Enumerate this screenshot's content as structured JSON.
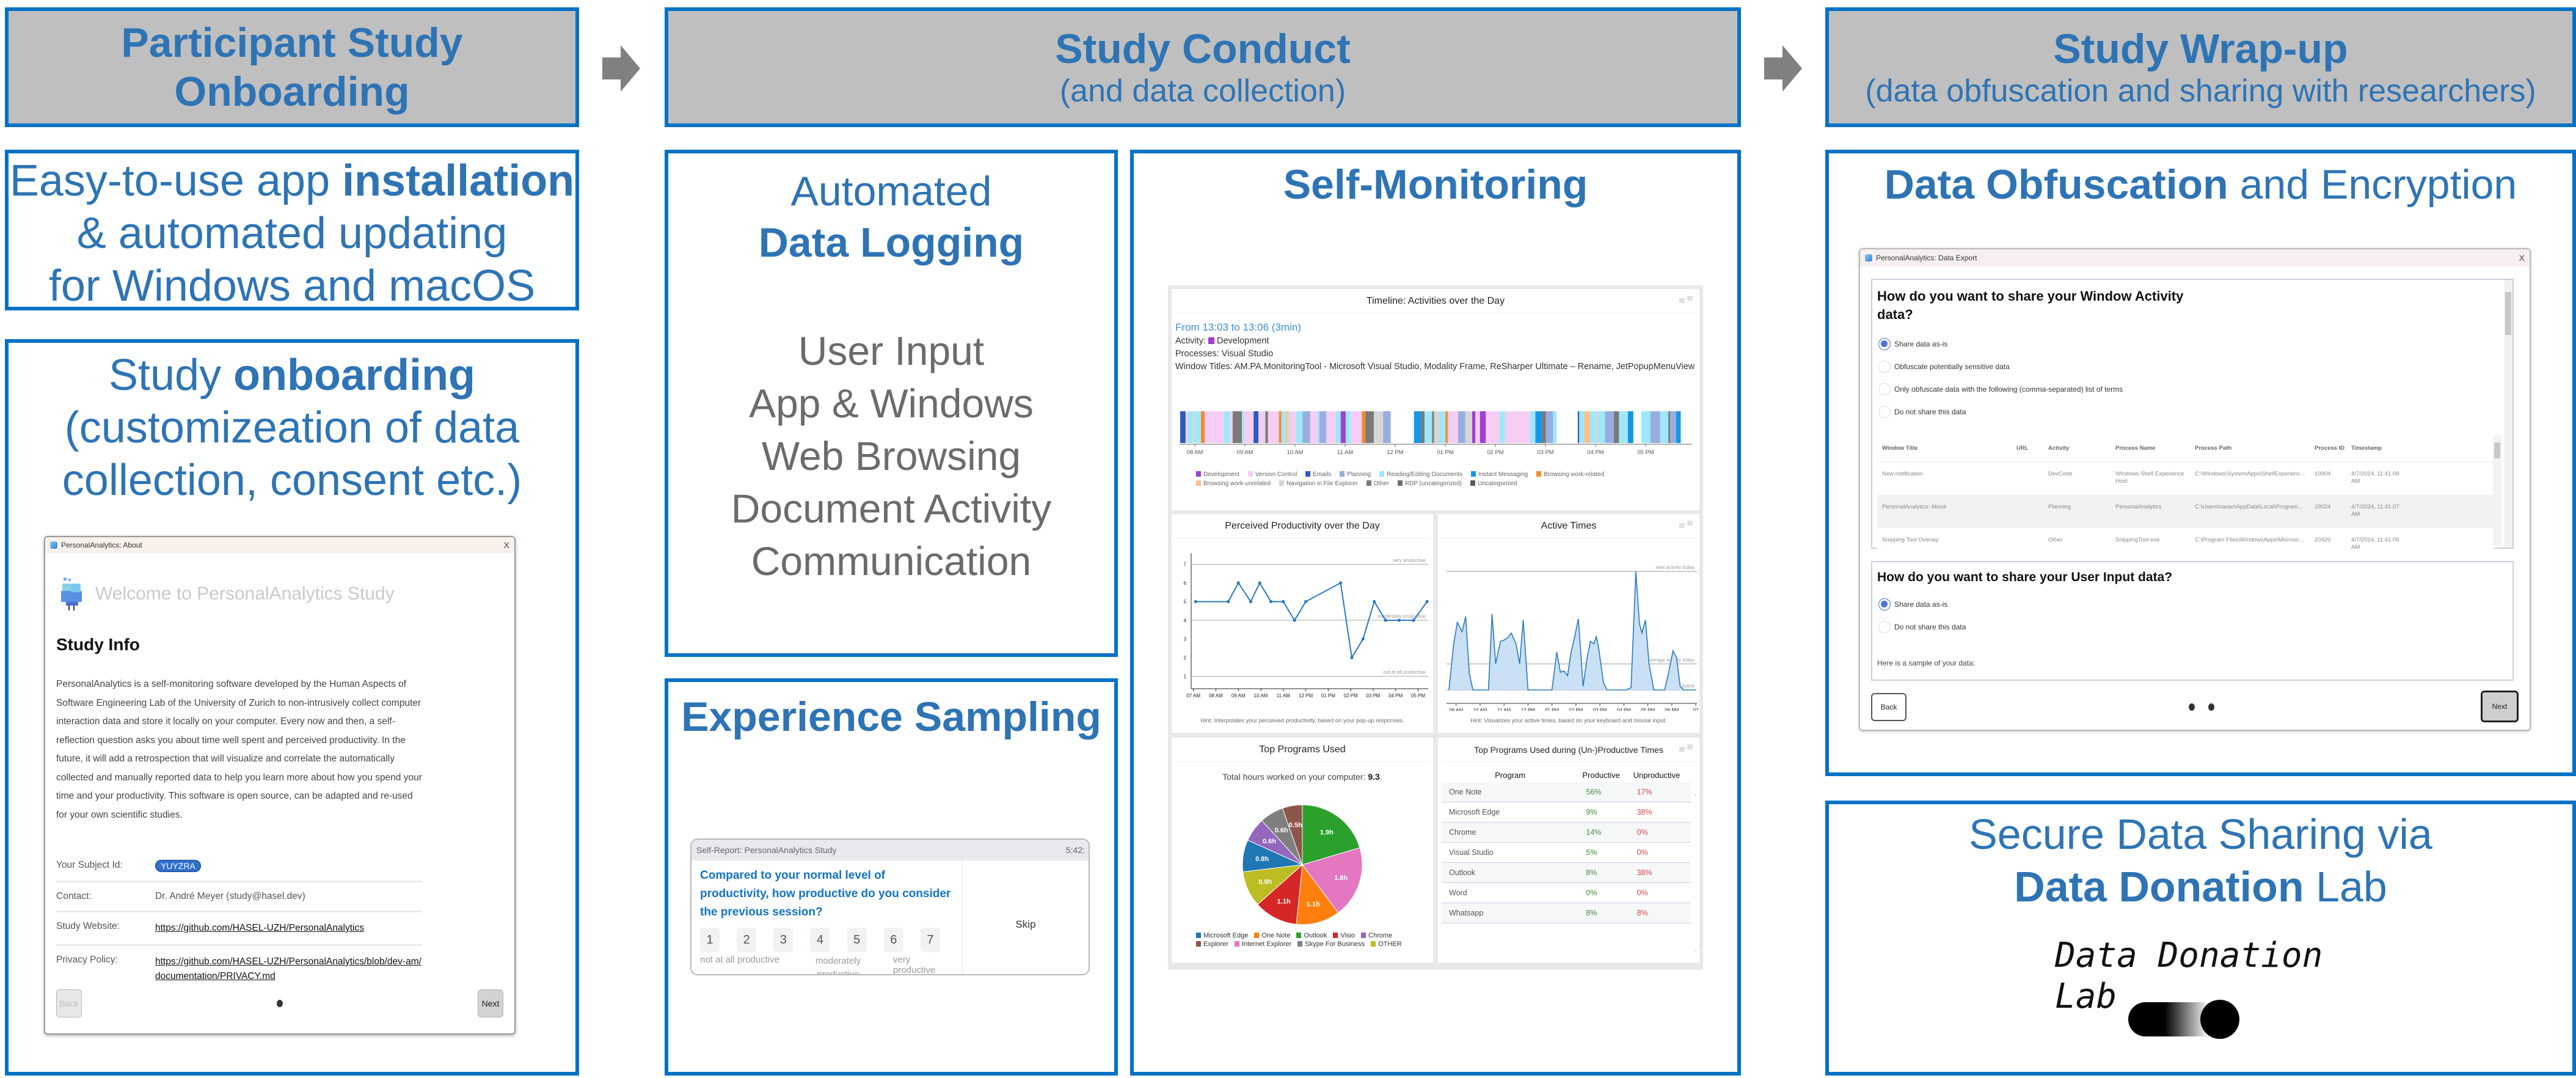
{
  "phases": [
    {
      "title": "Participant Study Onboarding",
      "subtitle": ""
    },
    {
      "title": "Study Conduct",
      "subtitle": "(and data collection)"
    },
    {
      "title": "Study Wrap-up",
      "subtitle": "(data obfuscation and sharing with researchers)"
    }
  ],
  "arrows": [
    "arrow-right-icon",
    "arrow-right-icon"
  ],
  "onboarding": {
    "install_box": {
      "line1_pre": "Easy-to-use app ",
      "line1_bold": "installation",
      "line2": "& automated updating",
      "line3": "for Windows and macOS"
    },
    "study_box": {
      "title_pre": "Study ",
      "title_bold": "onboarding",
      "line2": "(customizeation of data",
      "line3": "collection, consent etc.)"
    },
    "about_dialog": {
      "window_title": "PersonalAnalytics: About",
      "close": "X",
      "welcome": "Welcome to PersonalAnalytics Study",
      "heading": "Study Info",
      "description": "PersonalAnalytics is a self-monitoring software developed by the Human Aspects of Software Engineering Lab of the University of Zurich to non-intrusively collect computer interaction data and store it locally on your computer. Every now and then, a self-reflection question asks you about time well spent and perceived productivity. In the future, it will add a retrospection that will visualize and correlate the automatically collected and manually reported data to help you learn more about how you spend your time and your productivity. This software is open source, can be adapted and re-used for your own scientific studies.",
      "rows": [
        {
          "label": "Your Subject Id:",
          "value": "YUYZRA",
          "type": "badge"
        },
        {
          "label": "Contact:",
          "value": "Dr. André Meyer (study@hasel.dev)",
          "type": "text"
        },
        {
          "label": "Study Website:",
          "value": "https://github.com/HASEL-UZH/PersonalAnalytics",
          "type": "link"
        },
        {
          "label": "Privacy Policy:",
          "value": "https://github.com/HASEL-UZH/PersonalAnalytics/blob/dev-am/documentation/PRIVACY.md",
          "type": "link"
        }
      ],
      "back_label": "Back",
      "next_label": "Next",
      "page_dots": 1
    }
  },
  "conduct": {
    "logging": {
      "title_line1": "Automated",
      "title_line2": "Data Logging",
      "items": [
        "User Input",
        "App & Windows",
        "Web Browsing",
        "Document Activity",
        "Communication"
      ]
    },
    "experience_sampling": {
      "title": "Experience Sampling",
      "popup": {
        "header": "Self-Report: PersonalAnalytics Study",
        "time": "5:42:",
        "question": "Compared to your normal level of productivity, how productive do you consider the previous session?",
        "scale": [
          "1",
          "2",
          "3",
          "4",
          "5",
          "6",
          "7"
        ],
        "label_low": "not at all productive",
        "label_mid": "moderately productive",
        "label_high": "very productive",
        "skip_label": "Skip"
      }
    },
    "self_monitoring": {
      "title": "Self-Monitoring",
      "timeline": {
        "title": "Timeline: Activities over the Day",
        "from": "From 13:03 to 13:06 (3min)",
        "activity_label": "Activity:",
        "activity_value": "Development",
        "processes_label": "Processes:",
        "processes_value": "Visual Studio",
        "windows_label": "Window Titles:",
        "windows_value": "AM.PA.MonitoringTool - Microsoft Visual Studio, Modality Frame, ReSharper Ultimate – Rename, JetPopupMenuView",
        "ticks": [
          "08 AM",
          "09 AM",
          "10 AM",
          "11 AM",
          "12 PM",
          "01 PM",
          "02 PM",
          "03 PM",
          "04 PM",
          "05 PM"
        ],
        "legend": [
          {
            "label": "Development",
            "color": "#a03fd0"
          },
          {
            "label": "Version Control",
            "color": "#f5cdf3"
          },
          {
            "label": "Emails",
            "color": "#2a5cc0"
          },
          {
            "label": "Planning",
            "color": "#98aee0"
          },
          {
            "label": "Reading/Editing Documents",
            "color": "#9ee8fa"
          },
          {
            "label": "Instant Messaging",
            "color": "#1596e6"
          },
          {
            "label": "Browsing work-related",
            "color": "#f58a2a"
          },
          {
            "label": "Browsing work-unrelated",
            "color": "#fbc08e"
          },
          {
            "label": "Navigation in File Explorer",
            "color": "#d6d6d6"
          },
          {
            "label": "Other",
            "color": "#7a7a7a"
          },
          {
            "label": "RDP (uncategorized)",
            "color": "#6c6c6c"
          },
          {
            "label": "Uncategorized",
            "color": "#5c5c5c"
          }
        ]
      }
    }
  },
  "chart_data": [
    {
      "type": "line",
      "title": "Perceived Productivity over the Day",
      "xlabel": "",
      "ylabel": "",
      "x_ticks": [
        "07 AM",
        "08 AM",
        "09 AM",
        "10 AM",
        "11 AM",
        "12 PM",
        "01 PM",
        "02 PM",
        "03 PM",
        "04 PM",
        "05 PM"
      ],
      "y_ticks": [
        1,
        2,
        3,
        4,
        5,
        6,
        7
      ],
      "ylim": [
        0.4,
        7.6
      ],
      "xlim_hours": [
        6.9,
        17.45
      ],
      "reference_lines": [
        {
          "y": 7,
          "label": "very productive"
        },
        {
          "y": 4,
          "label": "moderately productive"
        },
        {
          "y": 1,
          "label": "not at all productive"
        }
      ],
      "x_hours": [
        7.1,
        8.55,
        9.0,
        9.55,
        9.95,
        10.45,
        11.0,
        11.5,
        12.0,
        13.55,
        14.05,
        14.55,
        15.05,
        15.55,
        16.15,
        16.8,
        17.4
      ],
      "values": [
        5,
        5,
        6,
        5,
        6,
        5,
        5,
        4,
        5,
        6,
        2,
        3,
        5,
        4,
        4,
        4,
        5
      ],
      "hint": "Hint: Interpolates your perceived productivity, based on your pop-up responses."
    },
    {
      "type": "area",
      "title": "Active Times",
      "x_ticks": [
        "09 AM",
        "10 AM",
        "11 AM",
        "12 PM",
        "01 PM",
        "02 PM",
        "03 PM",
        "04 PM",
        "05 PM",
        "06 PM",
        "07"
      ],
      "xlim_hours": [
        8.6,
        19.05
      ],
      "ylim": [
        0,
        1
      ],
      "reference_lines": [
        {
          "y": 1.0,
          "label": "max activity today"
        },
        {
          "y": 0.22,
          "label": "average activity today"
        },
        {
          "y": 0.0,
          "label": "not active"
        }
      ],
      "x_hours": [
        8.7,
        8.9,
        9.05,
        9.25,
        9.4,
        9.55,
        9.7,
        9.85,
        10.0,
        10.2,
        10.35,
        10.5,
        10.65,
        10.85,
        11.0,
        11.15,
        11.3,
        11.5,
        11.65,
        11.8,
        12.0,
        12.2,
        12.4,
        12.6,
        12.85,
        13.0,
        13.2,
        13.35,
        13.5,
        13.65,
        13.8,
        13.95,
        14.1,
        14.3,
        14.45,
        14.6,
        14.75,
        14.85,
        14.95,
        15.15,
        15.3,
        15.45,
        15.6,
        15.75,
        15.9,
        16.1,
        16.3,
        16.5,
        16.65,
        16.75,
        16.9,
        17.05,
        17.25,
        17.4,
        17.55,
        17.7,
        17.85,
        18.05,
        18.2,
        18.35,
        18.5,
        18.65,
        18.85,
        19.0
      ],
      "values": [
        0.0,
        0.39,
        0.57,
        0.49,
        0.62,
        0.14,
        0.0,
        0.0,
        0.0,
        0.0,
        0.0,
        0.64,
        0.22,
        0.41,
        0.42,
        0.44,
        0.48,
        0.39,
        0.22,
        0.59,
        0.0,
        0.0,
        0.0,
        0.0,
        0.0,
        0.0,
        0.32,
        0.15,
        0.16,
        0.12,
        0.32,
        0.45,
        0.6,
        0.03,
        0.25,
        0.41,
        0.39,
        0.45,
        0.35,
        0.06,
        0.0,
        0.0,
        0.0,
        0.0,
        0.0,
        0.0,
        0.02,
        1.0,
        0.56,
        0.48,
        0.59,
        0.22,
        0.0,
        0.0,
        0.0,
        0.0,
        0.13,
        0.33,
        0.27,
        0.03,
        0.0,
        0.0,
        0.0,
        0.0
      ],
      "hint": "Hint: Visualizes your active times, based on your keyboard and mouse input."
    },
    {
      "type": "pie",
      "title": "Top Programs Used",
      "subtitle_pre": "Total hours worked on your computer: ",
      "subtitle_value": "9.3",
      "subtitle_post": ".",
      "slices": [
        {
          "label": "Outlook",
          "value": 1.9,
          "text": "1.9h",
          "color": "#2ca02c"
        },
        {
          "label": "Internet Explorer",
          "value": 1.8,
          "text": "1.8h",
          "color": "#e377c2"
        },
        {
          "label": "One Note",
          "value": 1.1,
          "text": "1.1h",
          "color": "#ff7f0e"
        },
        {
          "label": "Visio",
          "value": 1.1,
          "text": "1.1h",
          "color": "#d62728"
        },
        {
          "label": "OTHER",
          "value": 0.9,
          "text": "0.9h",
          "color": "#bcbd22"
        },
        {
          "label": "Microsoft Edge",
          "value": 0.8,
          "text": "0.8h",
          "color": "#1f77b4"
        },
        {
          "label": "Chrome",
          "value": 0.6,
          "text": "0.6h",
          "color": "#9467bd"
        },
        {
          "label": "Skype For Business",
          "value": 0.6,
          "text": "0.6h",
          "color": "#7f7f7f"
        },
        {
          "label": "Explorer",
          "value": 0.5,
          "text": "0.5h",
          "color": "#8c564b"
        }
      ],
      "legend": [
        {
          "label": "Microsoft Edge",
          "color": "#1f77b4"
        },
        {
          "label": "One Note",
          "color": "#ff7f0e"
        },
        {
          "label": "Outlook",
          "color": "#2ca02c"
        },
        {
          "label": "Visio",
          "color": "#d62728"
        },
        {
          "label": "Chrome",
          "color": "#9467bd"
        },
        {
          "label": "Explorer",
          "color": "#8c564b"
        },
        {
          "label": "Internet Explorer",
          "color": "#e377c2"
        },
        {
          "label": "Skype For Business",
          "color": "#7f7f7f"
        },
        {
          "label": "OTHER",
          "color": "#bcbd22"
        }
      ]
    },
    {
      "type": "table",
      "title": "Top Programs Used during (Un-)Productive Times",
      "columns": [
        "Program",
        "Productive",
        "Unproductive"
      ],
      "rows": [
        [
          "One Note",
          "56%",
          "17%"
        ],
        [
          "Microsoft Edge",
          "9%",
          "38%"
        ],
        [
          "Chrome",
          "14%",
          "0%"
        ],
        [
          "Visual Studio",
          "5%",
          "0%"
        ],
        [
          "Outlook",
          "8%",
          "38%"
        ],
        [
          "Word",
          "0%",
          "0%"
        ],
        [
          "Whatsapp",
          "8%",
          "8%"
        ]
      ]
    }
  ],
  "wrapup": {
    "obfuscation": {
      "title_bold": "Data Obfuscation",
      "title_rest": " and Encryption",
      "dialog": {
        "window_title": "PersonalAnalytics: Data Export",
        "close": "X",
        "q1": "How do you want to share your Window Activity data?",
        "q1_options": [
          {
            "label": "Share data as-is",
            "selected": true
          },
          {
            "label": "Obfuscate potentially sensitive data",
            "selected": false
          },
          {
            "label": "Only obfuscate data with the following (comma-separated) list of terms",
            "selected": false
          },
          {
            "label": "Do not share this data",
            "selected": false
          }
        ],
        "table_columns": [
          "Window Title",
          "URL",
          "Activity",
          "Process Name",
          "Process Path",
          "Process ID",
          "Timestamp"
        ],
        "table_rows": [
          [
            "New notification",
            "",
            "DevCode",
            "Windows Shell Experience Host",
            "C:\\Windows\\SystemApps\\ShellExperienc...",
            "10904",
            "4/7/2024, 11:41:09 AM"
          ],
          [
            "PersonalAnalytics: About",
            "",
            "Planning",
            "PersonalAnalytics",
            "C:\\Users\\casao\\AppData\\Local\\Program...",
            "29024",
            "4/7/2024, 11:41:07 AM"
          ],
          [
            "Snipping Tool Overlay",
            "",
            "Other",
            "SnippingTool.exe",
            "C:\\Program Files\\WindowsApps\\Microso...",
            "20420",
            "4/7/2024, 11:41:05 AM"
          ]
        ],
        "q2": "How do you want to share your User Input data?",
        "q2_options": [
          {
            "label": "Share data as-is",
            "selected": true
          },
          {
            "label": "Do not share this data",
            "selected": false
          }
        ],
        "sample_label": "Here is a sample of your data:",
        "back_label": "Back",
        "next_label": "Next",
        "page_dots": 2
      }
    },
    "donation": {
      "line1": "Secure Data Sharing via",
      "line2_bold": "Data Donation",
      "line2_rest": " Lab",
      "logo_line1": "Data Donation",
      "logo_line2": "Lab"
    }
  }
}
